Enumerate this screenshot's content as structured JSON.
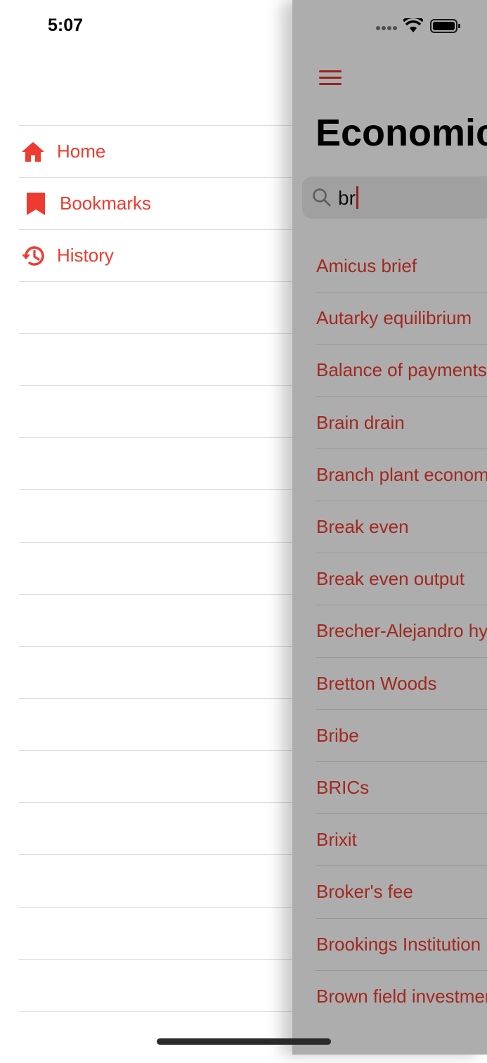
{
  "status": {
    "time": "5:07"
  },
  "menu": {
    "items": [
      {
        "label": "Home",
        "icon": "home-icon"
      },
      {
        "label": "Bookmarks",
        "icon": "bookmark-icon"
      },
      {
        "label": "History",
        "icon": "history-icon"
      }
    ]
  },
  "main": {
    "title": "Economics",
    "search": {
      "value": "br"
    },
    "results": [
      "Amicus brief",
      "Autarky equilibrium",
      "Balance of payments",
      "Brain drain",
      "Branch plant economy",
      "Break even",
      "Break even output",
      "Brecher-Alejandro hypothesis",
      "Bretton Woods",
      "Bribe",
      "BRICs",
      "Brixit",
      "Broker's fee",
      "Brookings Institution",
      "Brown field investment"
    ]
  },
  "colors": {
    "accent": "#ee3b30",
    "dim_overlay": "rgba(0,0,0,0.32)"
  }
}
